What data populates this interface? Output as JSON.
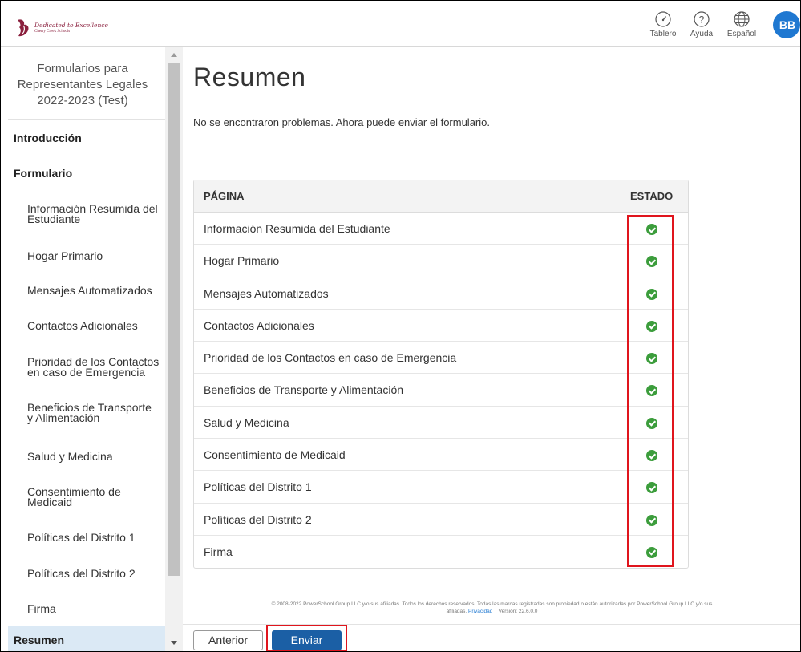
{
  "header": {
    "logo": {
      "line1": "Dedicated to Excellence",
      "line2": "Cherry Creek Schools"
    },
    "dashboard_label": "Tablero",
    "help_label": "Ayuda",
    "language_label": "Español",
    "avatar_initials": "BB"
  },
  "sidebar": {
    "title_lines": [
      "Formularios para",
      "Representantes Legales",
      "2022-2023 (Test)"
    ],
    "intro": "Introducción",
    "form_section": "Formulario",
    "items": [
      {
        "line1": "Información Resumida del",
        "line2": "Estudiante"
      },
      {
        "line1": "Hogar Primario",
        "line2": ""
      },
      {
        "line1": "Mensajes Automatizados",
        "line2": ""
      },
      {
        "line1": "Contactos Adicionales",
        "line2": ""
      },
      {
        "line1": "Prioridad de los Contactos",
        "line2": "en caso de Emergencia"
      },
      {
        "line1": "Beneficios de Transporte",
        "line2": "y Alimentación"
      },
      {
        "line1": "Salud y Medicina",
        "line2": ""
      },
      {
        "line1": "Consentimiento de",
        "line2": "Medicaid"
      },
      {
        "line1": "Políticas del Distrito 1",
        "line2": ""
      },
      {
        "line1": "Políticas del Distrito 2",
        "line2": ""
      },
      {
        "line1": "Firma",
        "line2": ""
      }
    ],
    "active": "Resumen"
  },
  "main": {
    "title": "Resumen",
    "message": "No se encontraron problemas. Ahora puede enviar el formulario.",
    "table": {
      "col_page": "PÁGINA",
      "col_status": "ESTADO",
      "rows": [
        "Información Resumida del Estudiante",
        "Hogar Primario",
        "Mensajes Automatizados",
        "Contactos Adicionales",
        "Prioridad de los Contactos en caso de Emergencia",
        "Beneficios de Transporte y Alimentación",
        "Salud y Medicina",
        "Consentimiento de Medicaid",
        "Políticas del Distrito 1",
        "Políticas del Distrito 2",
        "Firma"
      ]
    }
  },
  "footer": {
    "copyright": "© 2008-2022 PowerSchool Group LLC y/o sus afiliadas. Todos los derechos reservados. Todas las marcas registradas son propiedad o están autorizadas por PowerSchool Group LLC y/o sus",
    "line2_prefix": "afiliadas.",
    "privacy_link": "Privacidad",
    "version": "Versión: 22.6.0.0"
  },
  "buttons": {
    "prev": "Anterior",
    "send": "Enviar"
  },
  "colors": {
    "brand": "#8a1f3d",
    "primary": "#1b5fa5",
    "avatar": "#1f78d1",
    "success": "#3c9d3c",
    "highlight": "#e0151d"
  }
}
